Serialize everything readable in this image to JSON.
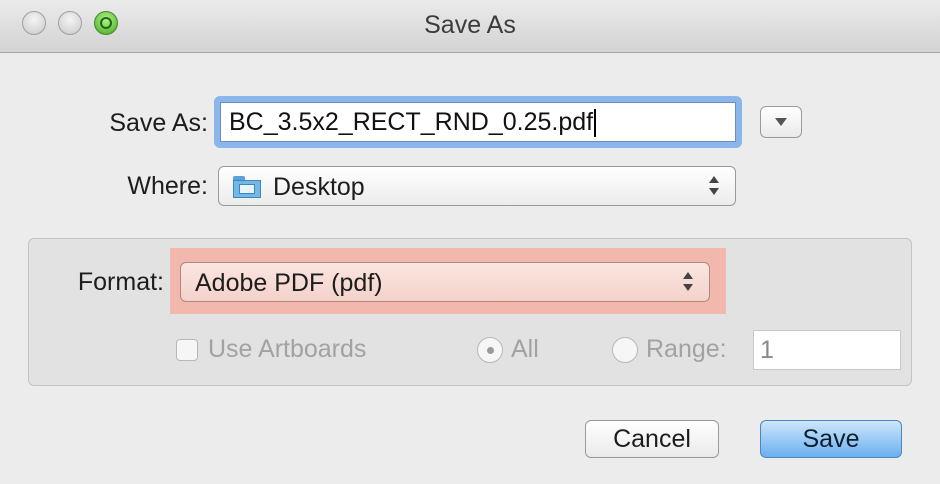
{
  "window": {
    "title": "Save As"
  },
  "save_as": {
    "label": "Save As:",
    "filename": "BC_3.5x2_RECT_RND_0.25.pdf"
  },
  "where": {
    "label": "Where:",
    "value": "Desktop",
    "icon": "folder-desktop-icon"
  },
  "options": {
    "format_label": "Format:",
    "format_value": "Adobe PDF (pdf)",
    "use_artboards_label": "Use Artboards",
    "use_artboards_checked": false,
    "all_label": "All",
    "range_label": "Range:",
    "range_value": "1"
  },
  "buttons": {
    "cancel": "Cancel",
    "save": "Save"
  },
  "colors": {
    "format_highlight": "#f2b7ad",
    "save_button": "#6ab0ef",
    "focus_ring": "#7fb0ea"
  }
}
